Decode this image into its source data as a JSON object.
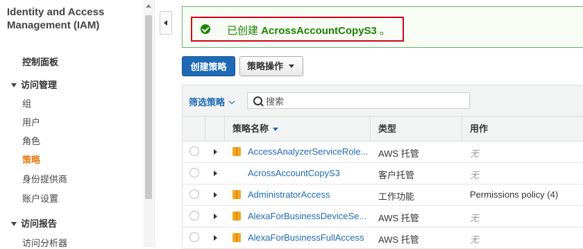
{
  "sidebar": {
    "title": "Identity and Access Management (IAM)",
    "dashboard": "控制面板",
    "access_management": "访问管理",
    "items": [
      {
        "label": "组"
      },
      {
        "label": "用户"
      },
      {
        "label": "角色"
      },
      {
        "label": "策略"
      },
      {
        "label": "身份提供商"
      },
      {
        "label": "账户设置"
      }
    ],
    "access_reports": "访问报告",
    "reports_items": [
      {
        "label": "访问分析器"
      }
    ],
    "accent_color": "#e47911"
  },
  "notice": {
    "prefix": "已创建",
    "policy_name": "AcrossAccountCopyS3",
    "suffix": "。",
    "color": "#1d8102"
  },
  "toolbar": {
    "create_label": "创建策略",
    "actions_label": "策略操作"
  },
  "filter": {
    "label": "筛选策略",
    "search_placeholder": "搜索"
  },
  "table": {
    "columns": [
      "策略名称",
      "类型",
      "用作"
    ],
    "rows": [
      {
        "name": "AccessAnalyzerServiceRole...",
        "type": "AWS 托管",
        "used_as": "无",
        "managed_icon": true
      },
      {
        "name": "AcrossAccountCopyS3",
        "type": "客户托管",
        "used_as": "无",
        "managed_icon": false
      },
      {
        "name": "AdministratorAccess",
        "type": "工作功能",
        "used_as": "Permissions policy (4)",
        "managed_icon": true
      },
      {
        "name": "AlexaForBusinessDeviceSe...",
        "type": "AWS 托管",
        "used_as": "无",
        "managed_icon": true
      },
      {
        "name": "AlexaForBusinessFullAccess",
        "type": "AWS 托管",
        "used_as": "无",
        "managed_icon": true
      }
    ]
  },
  "colors": {
    "primary": "#1f6ab6",
    "highlight_border": "#d0021b"
  }
}
